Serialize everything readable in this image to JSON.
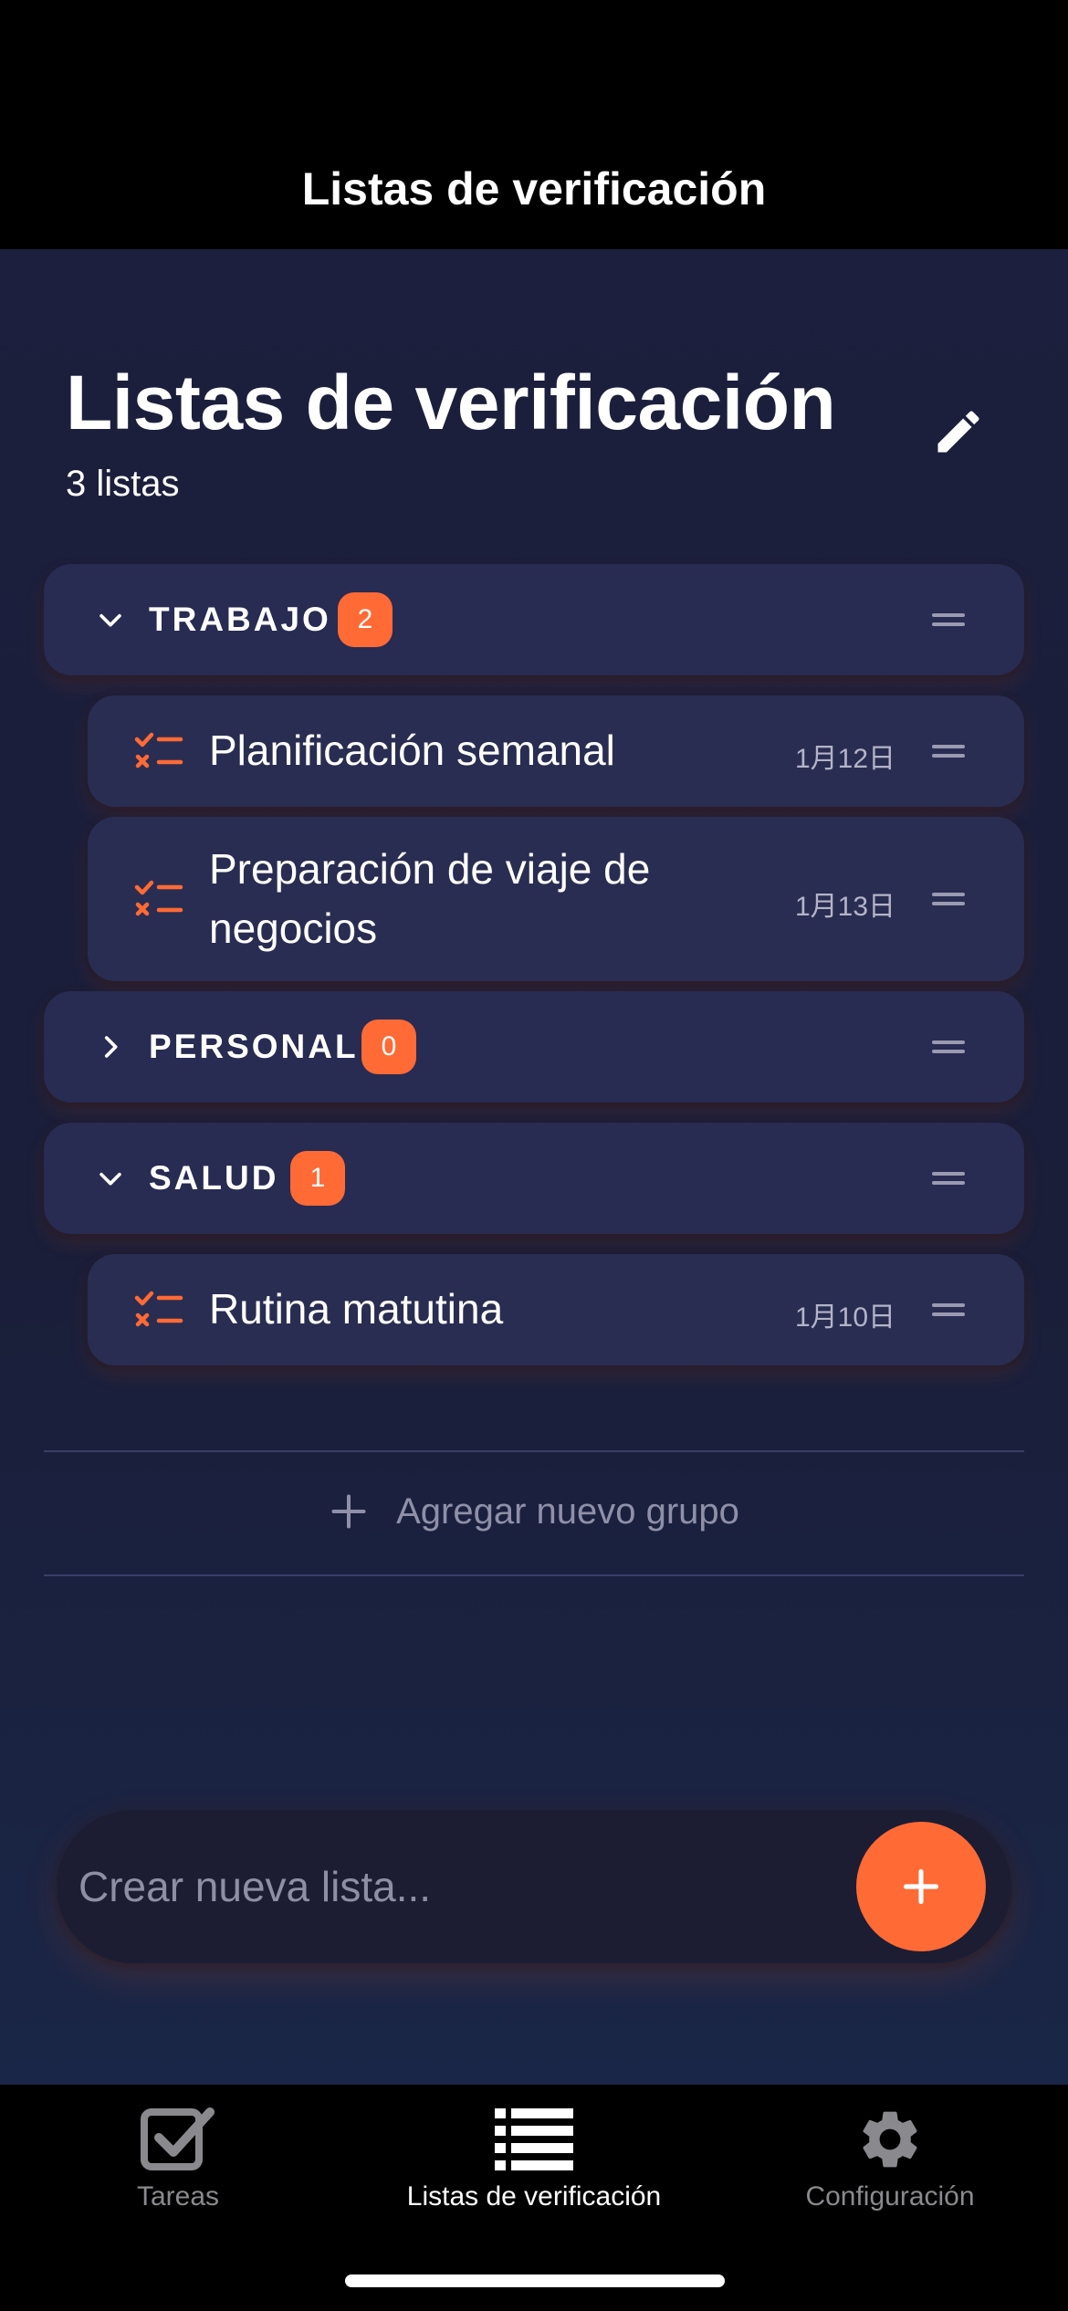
{
  "nav": {
    "title": "Listas de verificación"
  },
  "header": {
    "title": "Listas de verificación",
    "count": "3 listas"
  },
  "groups": [
    {
      "name": "TRABAJO",
      "count": "2",
      "expanded": true,
      "items": [
        {
          "title": "Planificación semanal",
          "date": "1月12日"
        },
        {
          "title": "Preparación de viaje de negocios",
          "date": "1月13日"
        }
      ]
    },
    {
      "name": "PERSONAL",
      "count": "0",
      "expanded": false,
      "items": []
    },
    {
      "name": "SALUD",
      "count": "1",
      "expanded": true,
      "items": [
        {
          "title": "Rutina matutina",
          "date": "1月10日"
        }
      ]
    }
  ],
  "add_group": {
    "label": "Agregar nuevo grupo"
  },
  "create": {
    "placeholder": "Crear nueva lista..."
  },
  "tabs": [
    {
      "label": "Tareas",
      "icon": "checkbox-icon",
      "active": false
    },
    {
      "label": "Listas de verificación",
      "icon": "list-icon",
      "active": true
    },
    {
      "label": "Configuración",
      "icon": "gear-icon",
      "active": false
    }
  ],
  "colors": {
    "accent": "#ff6a35",
    "card": "#282b52",
    "background": "#1c1f3d",
    "tab_inactive": "#8a8a8e"
  }
}
